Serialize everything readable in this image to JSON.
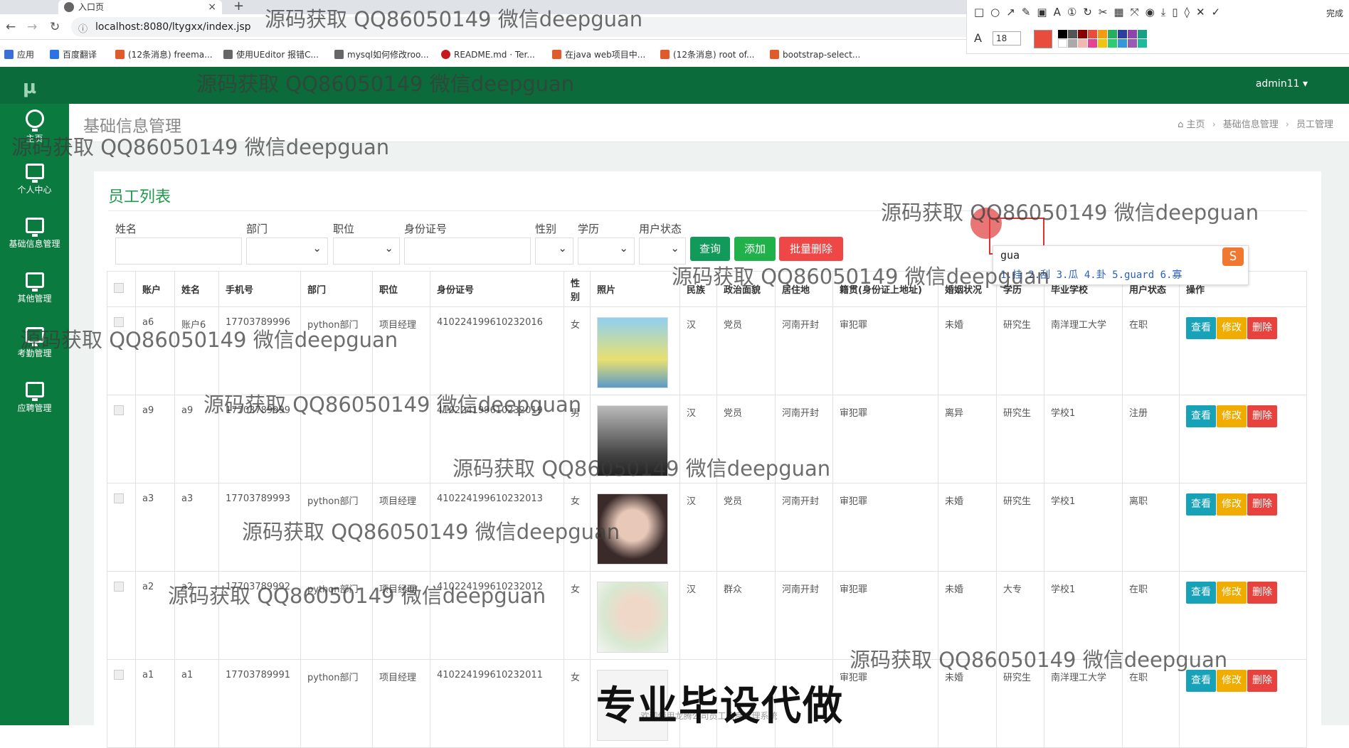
{
  "browser": {
    "tab_title": "入口页",
    "url": "localhost:8080/ltygxx/index.jsp",
    "bookmarks": [
      "应用",
      "百度翻译",
      "(12条消息) freema...",
      "使用UEditor 报错C...",
      "mysql如何修改roo...",
      "README.md · Ter...",
      "在java web项目中...",
      "(12条消息) root of...",
      "bootstrap-select..."
    ]
  },
  "annotation_toolbar": {
    "done_label": "完成",
    "font_size": "18"
  },
  "app": {
    "logo": "μ",
    "user": "admin11",
    "sidebar": [
      {
        "label": "主页"
      },
      {
        "label": "个人中心"
      },
      {
        "label": "基础信息管理"
      },
      {
        "label": "其他管理"
      },
      {
        "label": "考勤管理"
      },
      {
        "label": "应聘管理"
      }
    ],
    "page_title": "基础信息管理",
    "breadcrumb": [
      "主页",
      "基础信息管理",
      "员工管理"
    ]
  },
  "card": {
    "title": "员工列表",
    "filters": [
      "姓名",
      "部门",
      "职位",
      "身份证号",
      "性别",
      "学历",
      "用户状态"
    ],
    "buttons": {
      "query": "查询",
      "add": "添加",
      "batch_delete": "批量删除"
    }
  },
  "table": {
    "headers": [
      "账户",
      "姓名",
      "手机号",
      "部门",
      "职位",
      "身份证号",
      "性别",
      "照片",
      "民族",
      "政治面貌",
      "居住地",
      "籍贯(身份证上地址)",
      "婚姻状况",
      "学历",
      "毕业学校",
      "用户状态",
      "操作"
    ],
    "actions": {
      "view": "查看",
      "edit": "修改",
      "delete": "删除"
    },
    "rows": [
      {
        "account": "a6",
        "name": "账户6",
        "phone": "17703789996",
        "dept": "python部门",
        "position": "项目经理",
        "idcard": "410224199610232016",
        "gender": "女",
        "ethnic": "汉",
        "politics": "党员",
        "residence": "河南开封",
        "origin": "审犯罪",
        "marital": "未婚",
        "edu": "研究生",
        "school": "南洋理工大学",
        "status": "在职"
      },
      {
        "account": "a9",
        "name": "a9",
        "phone": "17703789999",
        "dept": "",
        "position": "",
        "idcard": "410224199610232019",
        "gender": "男",
        "ethnic": "汉",
        "politics": "党员",
        "residence": "河南开封",
        "origin": "审犯罪",
        "marital": "离异",
        "edu": "研究生",
        "school": "学校1",
        "status": "注册"
      },
      {
        "account": "a3",
        "name": "a3",
        "phone": "17703789993",
        "dept": "python部门",
        "position": "项目经理",
        "idcard": "410224199610232013",
        "gender": "女",
        "ethnic": "汉",
        "politics": "党员",
        "residence": "河南开封",
        "origin": "审犯罪",
        "marital": "未婚",
        "edu": "研究生",
        "school": "学校1",
        "status": "离职"
      },
      {
        "account": "a2",
        "name": "a2",
        "phone": "17703789992",
        "dept": "python部门",
        "position": "项目经理",
        "idcard": "410224199610232012",
        "gender": "女",
        "ethnic": "汉",
        "politics": "群众",
        "residence": "河南开封",
        "origin": "审犯罪",
        "marital": "未婚",
        "edu": "大专",
        "school": "学校1",
        "status": "在职"
      },
      {
        "account": "a1",
        "name": "a1",
        "phone": "17703789991",
        "dept": "python部门",
        "position": "项目经理",
        "idcard": "410224199610232011",
        "gender": "女",
        "ethnic": "",
        "politics": "",
        "residence": "",
        "origin": "审犯罪",
        "marital": "未婚",
        "edu": "研究生",
        "school": "南洋理工大学",
        "status": "在职"
      }
    ]
  },
  "ime": {
    "input": "gua",
    "candidates": "1.挂 2.刮 3.瓜 4.卦 5.guard 6.寡"
  },
  "watermark": "源码获取 QQ86050149 微信deepguan",
  "banner": "专业毕设代做",
  "footer": "欢迎使用龙腾公司员工信息管理系统"
}
